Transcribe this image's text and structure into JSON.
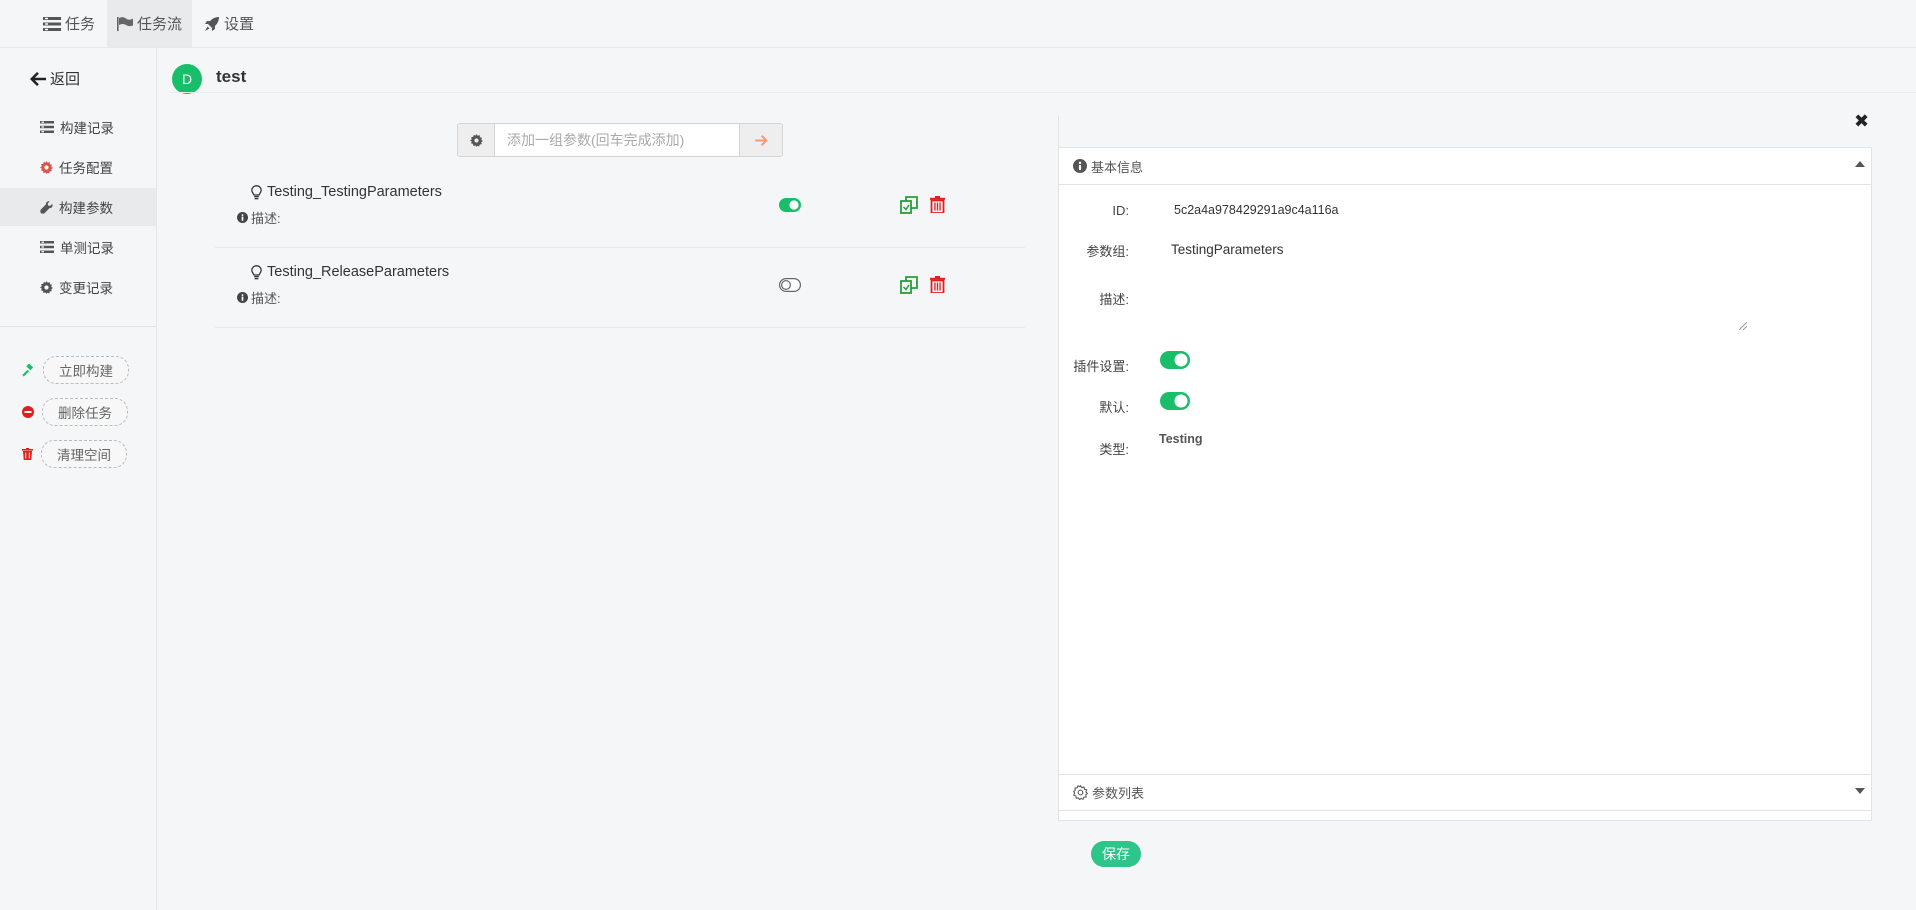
{
  "topnav": {
    "tabs": [
      {
        "label": "任务",
        "icon": "tasks-icon"
      },
      {
        "label": "任务流",
        "icon": "flag-icon",
        "active": true
      },
      {
        "label": "设置",
        "icon": "rocket-icon"
      }
    ]
  },
  "sidebar": {
    "back_label": "返回",
    "items": [
      {
        "label": "构建记录",
        "icon": "list-icon"
      },
      {
        "label": "任务配置",
        "icon": "gear-icon"
      },
      {
        "label": "构建参数",
        "icon": "wrench-icon",
        "active": true
      },
      {
        "label": "单测记录",
        "icon": "list-icon"
      },
      {
        "label": "变更记录",
        "icon": "gear-icon"
      }
    ],
    "actions": [
      {
        "label": "立即构建",
        "icon": "gavel-icon",
        "color": "#19be6b"
      },
      {
        "label": "删除任务",
        "icon": "minus-circle-icon",
        "color": "#e02020"
      },
      {
        "label": "清理空间",
        "icon": "trash-icon",
        "color": "#e02020"
      }
    ]
  },
  "header": {
    "avatar_letter": "D",
    "job_name": "test"
  },
  "add_param": {
    "placeholder": "添加一组参数(回车完成添加)"
  },
  "params": [
    {
      "name": "Testing_TestingParameters",
      "desc_label": "描述:",
      "enabled": true
    },
    {
      "name": "Testing_ReleaseParameters",
      "desc_label": "描述:",
      "enabled": false
    }
  ],
  "detail": {
    "section_basic": "基本信息",
    "section_params": "参数列表",
    "id_label": "ID:",
    "id_value": "5c2a4a978429291a9c4a116a",
    "group_label": "参数组:",
    "group_value": "TestingParameters",
    "desc_label": "描述:",
    "plugin_label": "插件设置:",
    "plugin_on": true,
    "default_label": "默认:",
    "default_on": true,
    "type_label": "类型:",
    "type_value": "Testing"
  },
  "save_label": "保存",
  "colors": {
    "accent": "#19be6b",
    "danger": "#e02020",
    "copy": "#2a9d3a"
  }
}
